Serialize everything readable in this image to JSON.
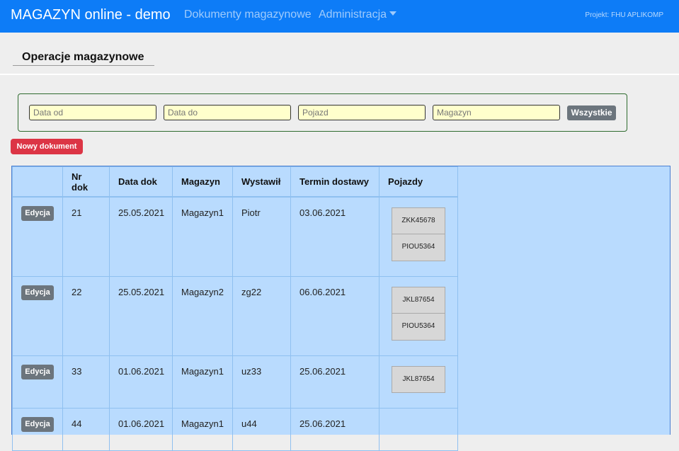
{
  "app": {
    "title": "MAGAZYN online - demo",
    "project": "Projekt: FHU APLIKOMP"
  },
  "nav": {
    "documents": "Dokumenty magazynowe",
    "admin": "Administracja"
  },
  "page": {
    "title": "Operacje magazynowe"
  },
  "filters": {
    "date_from": "Data od",
    "date_to": "Data do",
    "vehicle": "Pojazd",
    "warehouse": "Magazyn",
    "all_button": "Wszystkie"
  },
  "actions": {
    "new_document": "Nowy dokument",
    "edit": "Edycja"
  },
  "table": {
    "headers": [
      "",
      "Nr dok",
      "Data dok",
      "Magazyn",
      "Wystawił",
      "Termin dostawy",
      "Pojazdy"
    ],
    "rows": [
      {
        "nr": "21",
        "date": "25.05.2021",
        "warehouse": "Magazyn1",
        "issuer": "Piotr",
        "delivery": "03.06.2021",
        "vehicles": [
          "ZKK45678",
          "PIOU5364"
        ]
      },
      {
        "nr": "22",
        "date": "25.05.2021",
        "warehouse": "Magazyn2",
        "issuer": "zg22",
        "delivery": "06.06.2021",
        "vehicles": [
          "JKL87654",
          "PIOU5364"
        ]
      },
      {
        "nr": "33",
        "date": "01.06.2021",
        "warehouse": "Magazyn1",
        "issuer": "uz33",
        "delivery": "25.06.2021",
        "vehicles": [
          "JKL87654"
        ]
      },
      {
        "nr": "44",
        "date": "01.06.2021",
        "warehouse": "Magazyn1",
        "issuer": "u44",
        "delivery": "25.06.2021",
        "vehicles": []
      }
    ]
  },
  "colors": {
    "navbar": "#0d7cf7",
    "table_bg": "#b9dbfe",
    "filter_input_bg": "#ffffcc",
    "new_button": "#dc3545",
    "secondary_button": "#6c757d"
  }
}
